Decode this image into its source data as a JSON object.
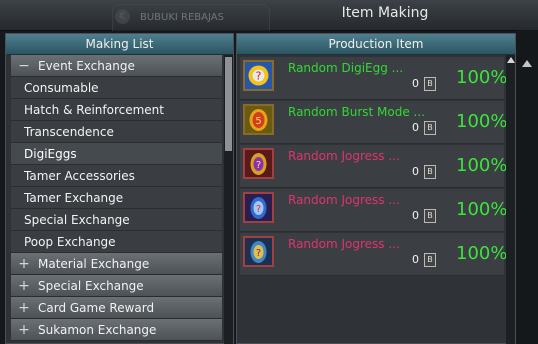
{
  "window": {
    "title": "Item Making",
    "background_tab": "BUBUKI REBAJAS",
    "background_tab_icon": "currency-icon"
  },
  "left_panel": {
    "header": "Making List",
    "categories_top": [
      {
        "sign": "−",
        "label": "Event Exchange",
        "expanded": true
      }
    ],
    "items": [
      {
        "label": "Consumable"
      },
      {
        "label": "Hatch & Reinforcement"
      },
      {
        "label": "Transcendence"
      },
      {
        "label": "DigiEggs",
        "selected": true
      },
      {
        "label": "Tamer Accessories"
      },
      {
        "label": "Tamer Exchange"
      },
      {
        "label": "Special Exchange"
      },
      {
        "label": "Poop Exchange"
      }
    ],
    "categories_bottom": [
      {
        "sign": "+",
        "label": "Material Exchange"
      },
      {
        "sign": "+",
        "label": "Special Exchange"
      },
      {
        "sign": "+",
        "label": "Card Game Reward"
      },
      {
        "sign": "+",
        "label": "Sukamon Exchange"
      }
    ]
  },
  "right_panel": {
    "header": "Production Item",
    "items": [
      {
        "name": "Random DigiEgg ...",
        "name_color": "#32d832",
        "qty": "0",
        "qty_icon": "B",
        "pct": "100%",
        "icon": "random-digiegg-icon"
      },
      {
        "name": "Random Burst Mode ...",
        "name_color": "#32d832",
        "qty": "0",
        "qty_icon": "B",
        "pct": "100%",
        "icon": "burst-mode-egg-icon"
      },
      {
        "name": "Random Jogress ...",
        "name_color": "#e0336c",
        "qty": "0",
        "qty_icon": "B",
        "pct": "100%",
        "icon": "jogress-egg-icon"
      },
      {
        "name": "Random Jogress ...",
        "name_color": "#e0336c",
        "qty": "0",
        "qty_icon": "B",
        "pct": "100%",
        "icon": "jogress-egg-icon"
      },
      {
        "name": "Random Jogress ...",
        "name_color": "#e0336c",
        "qty": "0",
        "qty_icon": "B",
        "pct": "100%",
        "icon": "jogress-egg-icon"
      }
    ]
  },
  "colors": {
    "header_teal": "#2c5562",
    "success_green": "#3be33b",
    "jogress_pink": "#e0336c"
  }
}
